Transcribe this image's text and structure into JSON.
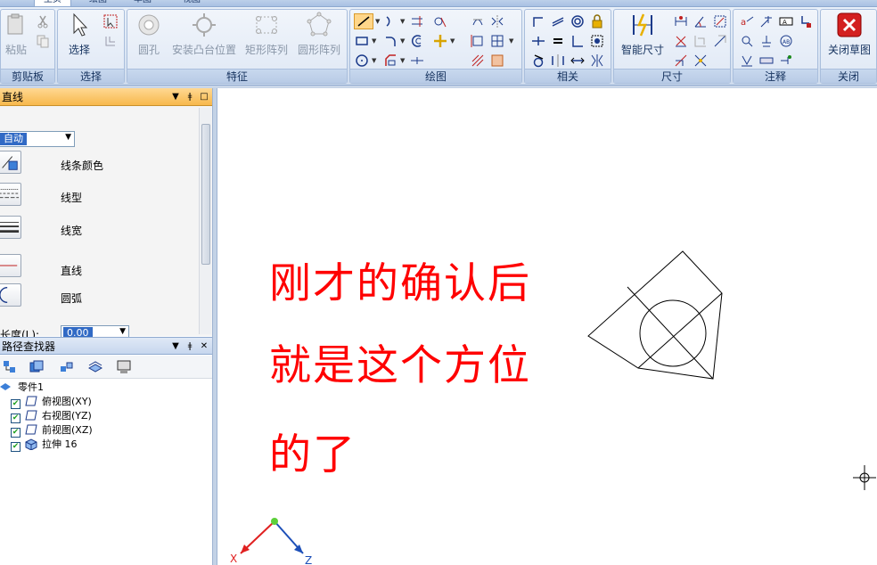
{
  "ribbon": {
    "tabs": [
      "主页",
      "绘图",
      "草图",
      "视图"
    ],
    "groups": {
      "clipboard": {
        "label": "剪贴板",
        "paste": "粘贴"
      },
      "select": {
        "label": "选择",
        "select": "选择"
      },
      "features": {
        "label": "特征",
        "hole": "圆孔",
        "mount_boss": "安装凸台位置",
        "rect_pattern": "矩形阵列",
        "circ_pattern": "圆形阵列"
      },
      "draw": {
        "label": "绘图"
      },
      "relate": {
        "label": "相关"
      },
      "dimension": {
        "label": "尺寸",
        "smart_dim": "智能尺寸"
      },
      "annotate": {
        "label": "注释"
      },
      "close": {
        "label": "关闭",
        "close_sketch": "关闭草图"
      }
    }
  },
  "line_panel": {
    "title": "直线",
    "mode_value": "自动",
    "line_color": "线条颜色",
    "line_type": "线型",
    "line_width": "线宽",
    "line": "直线",
    "arc": "圆弧",
    "length_label": "长度(L):",
    "length_value": "0.00"
  },
  "pathfinder": {
    "title": "路径查找器",
    "root": "零件1",
    "items": [
      "俯视图(XY)",
      "右视图(YZ)",
      "前视图(XZ)",
      "拉伸 16"
    ]
  },
  "canvas": {
    "annotation_lines": [
      "刚才的确认后",
      "就是这个方位",
      "的了"
    ],
    "axis_x": "X",
    "axis_z": "Z"
  },
  "colors": {
    "annotation": "#ff0000",
    "panel_active": "#f7b84c"
  }
}
